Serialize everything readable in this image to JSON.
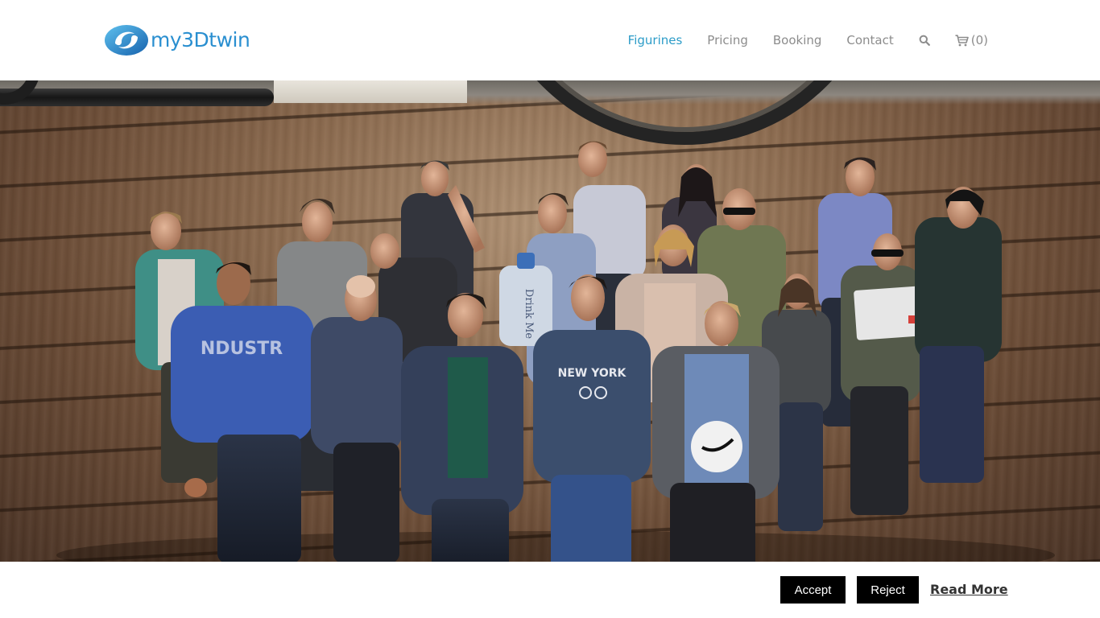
{
  "brand": {
    "name": "my3Dtwin",
    "color": "#2a8fd0"
  },
  "nav": {
    "items": [
      {
        "label": "Figurines",
        "active": true
      },
      {
        "label": "Pricing",
        "active": false
      },
      {
        "label": "Booking",
        "active": false
      },
      {
        "label": "Contact",
        "active": false
      }
    ],
    "search_icon": "search-icon",
    "cart_icon": "cart-icon",
    "cart_count": "(0)",
    "active_color": "#2c9cc8",
    "inactive_color": "#8c8c8c"
  },
  "hero": {
    "image": "group-of-3d-printed-figurines-on-wooden-floor",
    "shirt_text": "NEW YORK",
    "bottle_text": "Drink Me"
  },
  "cookie_bar": {
    "accept_label": "Accept",
    "reject_label": "Reject",
    "read_more_label": "Read More"
  }
}
